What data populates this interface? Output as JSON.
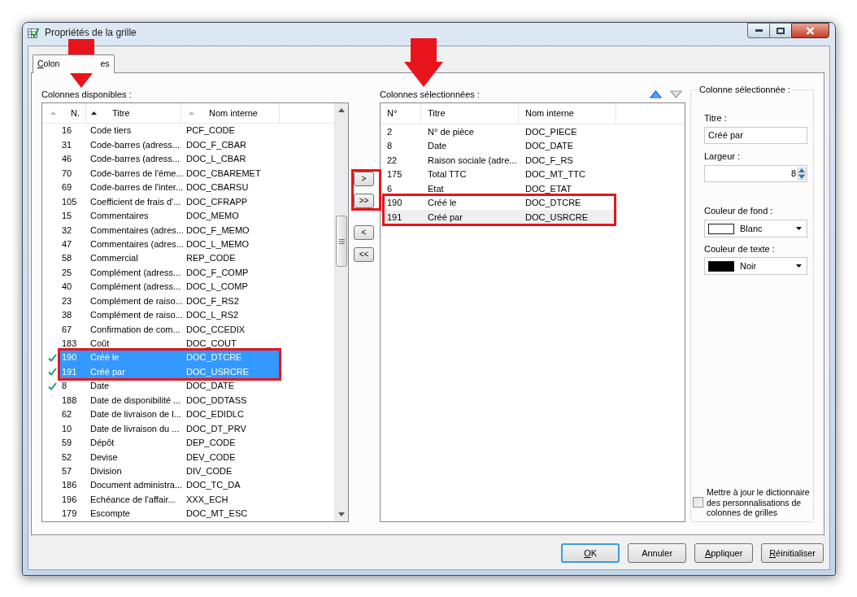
{
  "window": {
    "title": "Propriétés de la grille"
  },
  "tabs": [
    {
      "label_start": "Colon",
      "label_end": "es",
      "underline_first": true,
      "selected": true
    }
  ],
  "available": {
    "label": "Colonnes disponibles :",
    "arrow_marker": true,
    "focused": true,
    "columns": [
      {
        "label": "N.",
        "sorted": false
      },
      {
        "label": "Titre",
        "sorted": true
      },
      {
        "label": "Nom interne",
        "sorted": false
      }
    ],
    "rows": [
      {
        "number": "16",
        "title": "Code tiers",
        "internal_name": "PCF_CODE",
        "checked": false,
        "selected": false,
        "framed": false
      },
      {
        "number": "31",
        "title": "Code-barres (adress...",
        "internal_name": "DOC_F_CBAR",
        "checked": false,
        "selected": false,
        "framed": false
      },
      {
        "number": "46",
        "title": "Code-barres (adress...",
        "internal_name": "DOC_L_CBAR",
        "checked": false,
        "selected": false,
        "framed": false
      },
      {
        "number": "70",
        "title": "Code-barres de l'éme...",
        "internal_name": "DOC_CBAREMET",
        "checked": false,
        "selected": false,
        "framed": false
      },
      {
        "number": "69",
        "title": "Code-barres de l'inter...",
        "internal_name": "DOC_CBARSU",
        "checked": false,
        "selected": false,
        "framed": false
      },
      {
        "number": "105",
        "title": "Coefficient de frais d'...",
        "internal_name": "DOC_CFRAPP",
        "checked": false,
        "selected": false,
        "framed": false
      },
      {
        "number": "15",
        "title": "Commentaires",
        "internal_name": "DOC_MEMO",
        "checked": false,
        "selected": false,
        "framed": false
      },
      {
        "number": "32",
        "title": "Commentaires (adres...",
        "internal_name": "DOC_F_MEMO",
        "checked": false,
        "selected": false,
        "framed": false
      },
      {
        "number": "47",
        "title": "Commentaires (adres...",
        "internal_name": "DOC_L_MEMO",
        "checked": false,
        "selected": false,
        "framed": false
      },
      {
        "number": "58",
        "title": "Commercial",
        "internal_name": "REP_CODE",
        "checked": false,
        "selected": false,
        "framed": false
      },
      {
        "number": "25",
        "title": "Complément (adress...",
        "internal_name": "DOC_F_COMP",
        "checked": false,
        "selected": false,
        "framed": false
      },
      {
        "number": "40",
        "title": "Complément (adress...",
        "internal_name": "DOC_L_COMP",
        "checked": false,
        "selected": false,
        "framed": false
      },
      {
        "number": "23",
        "title": "Complément de raiso...",
        "internal_name": "DOC_F_RS2",
        "checked": false,
        "selected": false,
        "framed": false
      },
      {
        "number": "38",
        "title": "Complément de raiso...",
        "internal_name": "DOC_L_RS2",
        "checked": false,
        "selected": false,
        "framed": false
      },
      {
        "number": "67",
        "title": "Confirmation de com...",
        "internal_name": "DOC_CCEDIX",
        "checked": false,
        "selected": false,
        "framed": false
      },
      {
        "number": "183",
        "title": "Coût",
        "internal_name": "DOC_COUT",
        "checked": false,
        "selected": false,
        "framed": false
      },
      {
        "number": "190",
        "title": "Créé le",
        "internal_name": "DOC_DTCRE",
        "checked": true,
        "selected": true,
        "framed": true
      },
      {
        "number": "191",
        "title": "Créé par",
        "internal_name": "DOC_USRCRE",
        "checked": true,
        "selected": true,
        "framed": true
      },
      {
        "number": "8",
        "title": "Date",
        "internal_name": "DOC_DATE",
        "checked": true,
        "selected": false,
        "framed": false
      },
      {
        "number": "188",
        "title": "Date de disponibilité ...",
        "internal_name": "DOC_DDTASS",
        "checked": false,
        "selected": false,
        "framed": false
      },
      {
        "number": "62",
        "title": "Date de livraison de l...",
        "internal_name": "DOC_EDIDLC",
        "checked": false,
        "selected": false,
        "framed": false
      },
      {
        "number": "10",
        "title": "Date de livraison du ...",
        "internal_name": "DOC_DT_PRV",
        "checked": false,
        "selected": false,
        "framed": false
      },
      {
        "number": "59",
        "title": "Dépôt",
        "internal_name": "DEP_CODE",
        "checked": false,
        "selected": false,
        "framed": false
      },
      {
        "number": "52",
        "title": "Devise",
        "internal_name": "DEV_CODE",
        "checked": false,
        "selected": false,
        "framed": false
      },
      {
        "number": "57",
        "title": "Division",
        "internal_name": "DIV_CODE",
        "checked": false,
        "selected": false,
        "framed": false
      },
      {
        "number": "186",
        "title": "Document administra...",
        "internal_name": "DOC_TC_DA",
        "checked": false,
        "selected": false,
        "framed": false
      },
      {
        "number": "196",
        "title": "Echéance de l'affair...",
        "internal_name": "XXX_ECH",
        "checked": false,
        "selected": false,
        "framed": false
      },
      {
        "number": "179",
        "title": "Escompte",
        "internal_name": "DOC_MT_ESC",
        "checked": false,
        "selected": false,
        "framed": false
      }
    ]
  },
  "transfer_buttons": [
    {
      "label": ">",
      "framed": true
    },
    {
      "label": ">>",
      "framed": true
    },
    {
      "label": "<",
      "framed": false
    },
    {
      "label": "<<",
      "framed": false
    }
  ],
  "selected_columns": {
    "label": "Colonnes sélectionnées :",
    "arrow_marker": true,
    "focused": false,
    "order_buttons": [
      {
        "kind": "up",
        "disabled": false
      },
      {
        "kind": "down",
        "disabled": true
      }
    ],
    "columns": [
      {
        "label": "N°"
      },
      {
        "label": "Titre"
      },
      {
        "label": "Nom interne"
      }
    ],
    "rows": [
      {
        "number": "2",
        "title": "N° de pièce",
        "internal_name": "DOC_PIECE",
        "selected": false,
        "framed": false
      },
      {
        "number": "8",
        "title": "Date",
        "internal_name": "DOC_DATE",
        "selected": false,
        "framed": false
      },
      {
        "number": "22",
        "title": "Raison sociale (adre...",
        "internal_name": "DOC_F_RS",
        "selected": false,
        "framed": false
      },
      {
        "number": "175",
        "title": "Total TTC",
        "internal_name": "DOC_MT_TTC",
        "selected": false,
        "framed": false
      },
      {
        "number": "6",
        "title": "Etat",
        "internal_name": "DOC_ETAT",
        "selected": false,
        "framed": false
      },
      {
        "number": "190",
        "title": "Créé le",
        "internal_name": "DOC_DTCRE",
        "selected": false,
        "framed": true
      },
      {
        "number": "191",
        "title": "Créé par",
        "internal_name": "DOC_USRCRE",
        "selected": true,
        "framed": true
      }
    ]
  },
  "column_properties": {
    "group_title": "Colonne sélectionnée :",
    "title_label": "Titre :",
    "title_value": "Créé par",
    "width_label": "Largeur :",
    "width_value": "8",
    "background_label": "Couleur de fond :",
    "background": {
      "name": "Blanc",
      "color": "#ffffff"
    },
    "text_color_label": "Couleur de texte :",
    "text_color": {
      "name": "Noir",
      "color": "#000000"
    },
    "update_dictionary": {
      "label": "Mettre à jour le dictionnaire des personnalisations de colonnes de grilles",
      "checked": false
    }
  },
  "buttons": [
    {
      "label": "OK",
      "underline_first": true,
      "default": true
    },
    {
      "label": "Annuler",
      "underline_first": false,
      "default": false
    },
    {
      "label": "Appliquer",
      "underline_first": true,
      "default": false
    },
    {
      "label": "Réinitialiser",
      "underline_first": true,
      "default": false
    }
  ]
}
